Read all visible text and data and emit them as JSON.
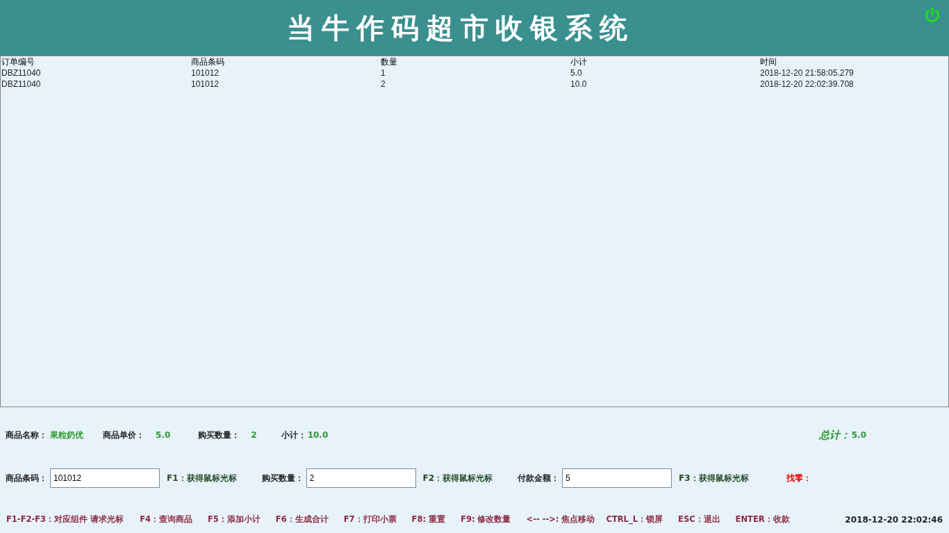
{
  "header": {
    "title": "当牛作码超市收银系统"
  },
  "table": {
    "columns": [
      "订单编号",
      "商品条码",
      "数量",
      "小计",
      "时间"
    ],
    "rows": [
      [
        "DBZ11040",
        "101012",
        "1",
        "5.0",
        "2018-12-20 21:58:05.279"
      ],
      [
        "DBZ11040",
        "101012",
        "2",
        "10.0",
        "2018-12-20 22:02:39.708"
      ]
    ]
  },
  "info": [
    {
      "label": "商品名称：",
      "value": "果粒奶优"
    },
    {
      "label": "商品单价：",
      "value": "5.0"
    },
    {
      "label": "购买数量：",
      "value": "2"
    },
    {
      "label": "小计：",
      "value": "10.0"
    }
  ],
  "total": {
    "label": "总计：",
    "value": "5.0"
  },
  "fields": [
    {
      "label": "商品条码：",
      "value": "101012",
      "hint": "F1：获得鼠标光标"
    },
    {
      "label": "购买数量：",
      "value": "2",
      "hint": "F2：获得鼠标光标"
    },
    {
      "label": "付款金额：",
      "value": "5",
      "hint": "F3：获得鼠标光标"
    }
  ],
  "change": {
    "label": "找零："
  },
  "shortcuts": [
    "F1-F2-F3：对应组件 请求光标",
    "F4：查询商品",
    "F5：添加小计",
    "F6：生成合计",
    "F7：打印小票",
    "F8: 重置",
    "F9: 修改数量",
    "<--  -->: 焦点移动",
    "CTRL_L：锁屏",
    "ESC：退出",
    "ENTER：收款"
  ],
  "clock": "2018-12-20 22:02:46"
}
